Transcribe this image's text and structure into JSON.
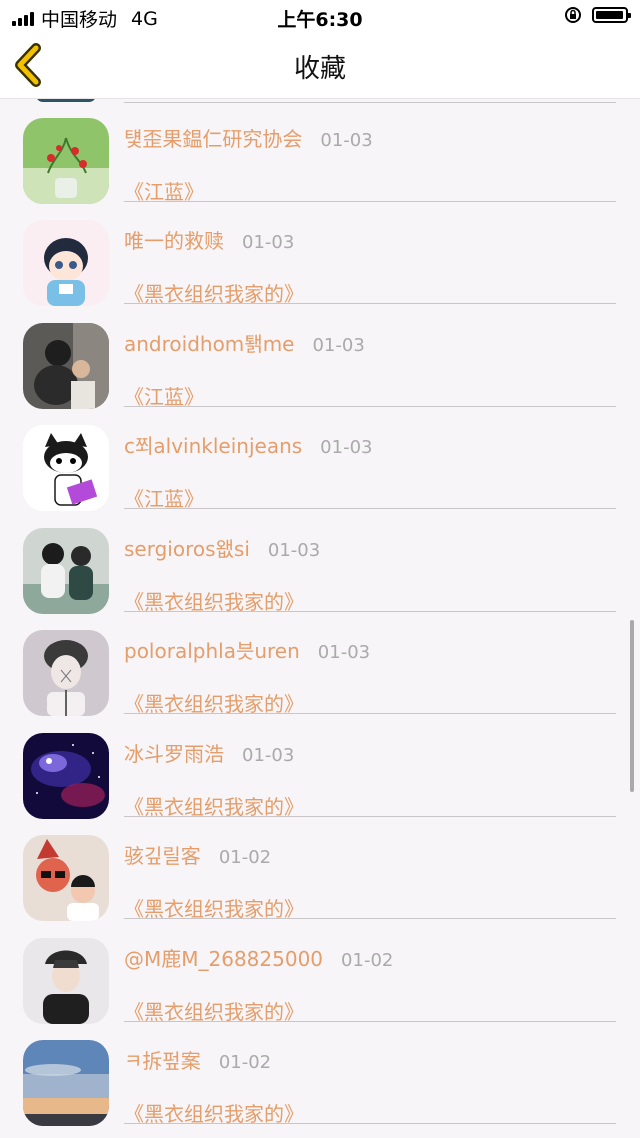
{
  "status_bar": {
    "carrier": "中国移动",
    "network": "4G",
    "time": "上午6:30"
  },
  "nav": {
    "title": "收藏"
  },
  "items": [
    {
      "name": "턫歪果鎾仁研究协会",
      "date": "01-03",
      "book": "《江蓝》",
      "avatar": "strawberry-plant-avatar"
    },
    {
      "name": "唯一的救赎",
      "date": "01-03",
      "book": "《黑衣组织我家的》",
      "avatar": "anime-boy-avatar"
    },
    {
      "name": "androidhom퇡me",
      "date": "01-03",
      "book": "《江蓝》",
      "avatar": "couple-photo-avatar"
    },
    {
      "name": "c쬐alvinkleinjeans",
      "date": "01-03",
      "book": "《江蓝》",
      "avatar": "cartoon-cat-avatar"
    },
    {
      "name": "sergioros왮si",
      "date": "01-03",
      "book": "《黑衣组织我家的》",
      "avatar": "couple-sitting-avatar"
    },
    {
      "name": "poloralphla븟uren",
      "date": "01-03",
      "book": "《黑衣组织我家的》",
      "avatar": "sketch-boy-avatar"
    },
    {
      "name": "冰斗罗雨浩",
      "date": "01-03",
      "book": "《黑衣组织我家的》",
      "avatar": "galaxy-avatar"
    },
    {
      "name": "骇깊릴客",
      "date": "01-02",
      "book": "《黑衣组织我家的》",
      "avatar": "kids-photo-avatar"
    },
    {
      "name": "@M鹿M_268825000",
      "date": "01-02",
      "book": "《黑衣组织我家的》",
      "avatar": "young-man-avatar"
    },
    {
      "name": "ㅋ拆펖案",
      "date": "01-02",
      "book": "《黑衣组织我家的》",
      "avatar": "sunset-sky-avatar"
    }
  ]
}
